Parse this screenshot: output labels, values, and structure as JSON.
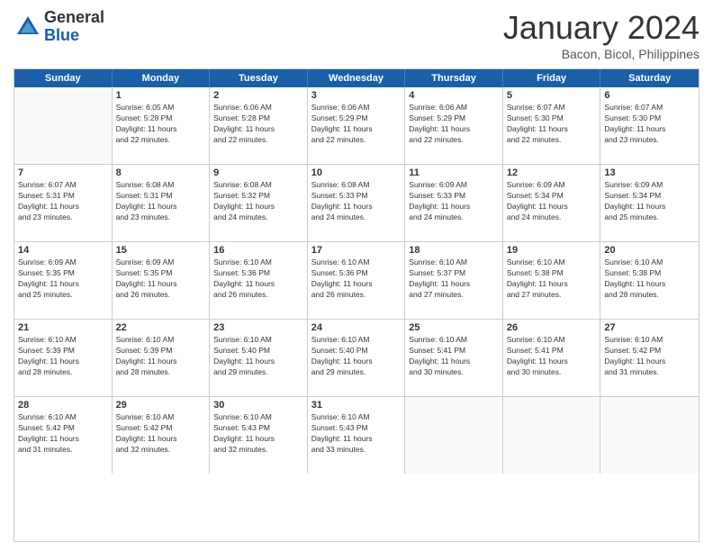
{
  "header": {
    "logo_general": "General",
    "logo_blue": "Blue",
    "month_title": "January 2024",
    "location": "Bacon, Bicol, Philippines"
  },
  "weekdays": [
    "Sunday",
    "Monday",
    "Tuesday",
    "Wednesday",
    "Thursday",
    "Friday",
    "Saturday"
  ],
  "weeks": [
    [
      {
        "day": "",
        "info": ""
      },
      {
        "day": "1",
        "info": "Sunrise: 6:05 AM\nSunset: 5:28 PM\nDaylight: 11 hours\nand 22 minutes."
      },
      {
        "day": "2",
        "info": "Sunrise: 6:06 AM\nSunset: 5:28 PM\nDaylight: 11 hours\nand 22 minutes."
      },
      {
        "day": "3",
        "info": "Sunrise: 6:06 AM\nSunset: 5:29 PM\nDaylight: 11 hours\nand 22 minutes."
      },
      {
        "day": "4",
        "info": "Sunrise: 6:06 AM\nSunset: 5:29 PM\nDaylight: 11 hours\nand 22 minutes."
      },
      {
        "day": "5",
        "info": "Sunrise: 6:07 AM\nSunset: 5:30 PM\nDaylight: 11 hours\nand 22 minutes."
      },
      {
        "day": "6",
        "info": "Sunrise: 6:07 AM\nSunset: 5:30 PM\nDaylight: 11 hours\nand 23 minutes."
      }
    ],
    [
      {
        "day": "7",
        "info": "Sunrise: 6:07 AM\nSunset: 5:31 PM\nDaylight: 11 hours\nand 23 minutes."
      },
      {
        "day": "8",
        "info": "Sunrise: 6:08 AM\nSunset: 5:31 PM\nDaylight: 11 hours\nand 23 minutes."
      },
      {
        "day": "9",
        "info": "Sunrise: 6:08 AM\nSunset: 5:32 PM\nDaylight: 11 hours\nand 24 minutes."
      },
      {
        "day": "10",
        "info": "Sunrise: 6:08 AM\nSunset: 5:33 PM\nDaylight: 11 hours\nand 24 minutes."
      },
      {
        "day": "11",
        "info": "Sunrise: 6:09 AM\nSunset: 5:33 PM\nDaylight: 11 hours\nand 24 minutes."
      },
      {
        "day": "12",
        "info": "Sunrise: 6:09 AM\nSunset: 5:34 PM\nDaylight: 11 hours\nand 24 minutes."
      },
      {
        "day": "13",
        "info": "Sunrise: 6:09 AM\nSunset: 5:34 PM\nDaylight: 11 hours\nand 25 minutes."
      }
    ],
    [
      {
        "day": "14",
        "info": "Sunrise: 6:09 AM\nSunset: 5:35 PM\nDaylight: 11 hours\nand 25 minutes."
      },
      {
        "day": "15",
        "info": "Sunrise: 6:09 AM\nSunset: 5:35 PM\nDaylight: 11 hours\nand 26 minutes."
      },
      {
        "day": "16",
        "info": "Sunrise: 6:10 AM\nSunset: 5:36 PM\nDaylight: 11 hours\nand 26 minutes."
      },
      {
        "day": "17",
        "info": "Sunrise: 6:10 AM\nSunset: 5:36 PM\nDaylight: 11 hours\nand 26 minutes."
      },
      {
        "day": "18",
        "info": "Sunrise: 6:10 AM\nSunset: 5:37 PM\nDaylight: 11 hours\nand 27 minutes."
      },
      {
        "day": "19",
        "info": "Sunrise: 6:10 AM\nSunset: 5:38 PM\nDaylight: 11 hours\nand 27 minutes."
      },
      {
        "day": "20",
        "info": "Sunrise: 6:10 AM\nSunset: 5:38 PM\nDaylight: 11 hours\nand 28 minutes."
      }
    ],
    [
      {
        "day": "21",
        "info": "Sunrise: 6:10 AM\nSunset: 5:39 PM\nDaylight: 11 hours\nand 28 minutes."
      },
      {
        "day": "22",
        "info": "Sunrise: 6:10 AM\nSunset: 5:39 PM\nDaylight: 11 hours\nand 28 minutes."
      },
      {
        "day": "23",
        "info": "Sunrise: 6:10 AM\nSunset: 5:40 PM\nDaylight: 11 hours\nand 29 minutes."
      },
      {
        "day": "24",
        "info": "Sunrise: 6:10 AM\nSunset: 5:40 PM\nDaylight: 11 hours\nand 29 minutes."
      },
      {
        "day": "25",
        "info": "Sunrise: 6:10 AM\nSunset: 5:41 PM\nDaylight: 11 hours\nand 30 minutes."
      },
      {
        "day": "26",
        "info": "Sunrise: 6:10 AM\nSunset: 5:41 PM\nDaylight: 11 hours\nand 30 minutes."
      },
      {
        "day": "27",
        "info": "Sunrise: 6:10 AM\nSunset: 5:42 PM\nDaylight: 11 hours\nand 31 minutes."
      }
    ],
    [
      {
        "day": "28",
        "info": "Sunrise: 6:10 AM\nSunset: 5:42 PM\nDaylight: 11 hours\nand 31 minutes."
      },
      {
        "day": "29",
        "info": "Sunrise: 6:10 AM\nSunset: 5:42 PM\nDaylight: 11 hours\nand 32 minutes."
      },
      {
        "day": "30",
        "info": "Sunrise: 6:10 AM\nSunset: 5:43 PM\nDaylight: 11 hours\nand 32 minutes."
      },
      {
        "day": "31",
        "info": "Sunrise: 6:10 AM\nSunset: 5:43 PM\nDaylight: 11 hours\nand 33 minutes."
      },
      {
        "day": "",
        "info": ""
      },
      {
        "day": "",
        "info": ""
      },
      {
        "day": "",
        "info": ""
      }
    ]
  ]
}
